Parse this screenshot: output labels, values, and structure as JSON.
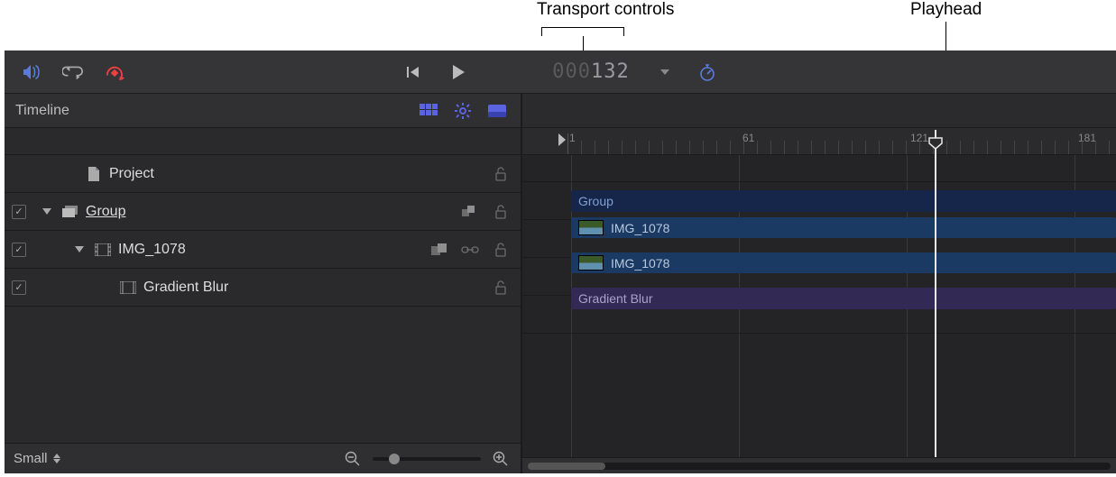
{
  "callouts": {
    "transport": "Transport controls",
    "playhead": "Playhead"
  },
  "transport": {
    "time_dim": "000",
    "time_lit": "132"
  },
  "leftHeader": {
    "title": "Timeline"
  },
  "layers": {
    "project": "Project",
    "group": "Group",
    "clip1": "IMG_1078",
    "filter": "Gradient Blur"
  },
  "ruler": {
    "t1": "1",
    "t2": "61",
    "t3": "121",
    "t4": "181"
  },
  "clips": {
    "group": "Group",
    "img_a": "IMG_1078",
    "img_b": "IMG_1078",
    "fx": "Gradient Blur"
  },
  "footer": {
    "size": "Small"
  }
}
